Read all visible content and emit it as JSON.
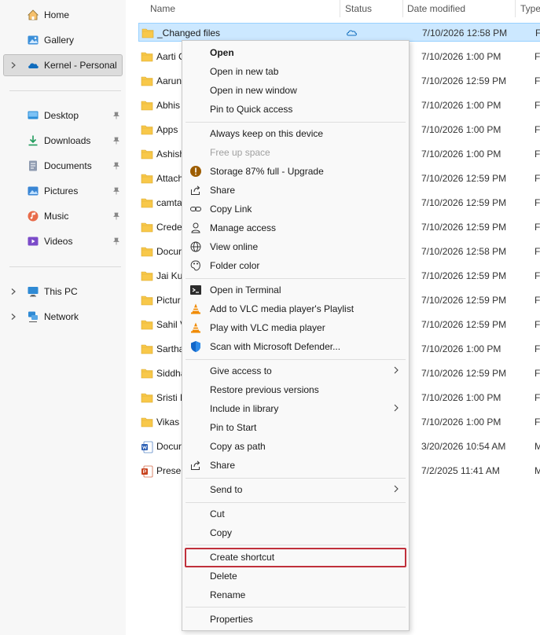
{
  "sidebar": {
    "home": "Home",
    "gallery": "Gallery",
    "kernel": "Kernel - Personal",
    "quick": [
      "Desktop",
      "Downloads",
      "Documents",
      "Pictures",
      "Music",
      "Videos"
    ],
    "this_pc": "This PC",
    "network": "Network"
  },
  "columns": {
    "name": "Name",
    "status": "Status",
    "date": "Date modified",
    "type": "Type"
  },
  "files": [
    {
      "name": "_Changed files",
      "date": "7/10/2026 12:58 PM",
      "type": "File f"
    },
    {
      "name": "Aarti C",
      "date": "7/10/2026 1:00 PM",
      "type": "File f"
    },
    {
      "name": "Aarun",
      "date": "7/10/2026 12:59 PM",
      "type": "File f"
    },
    {
      "name": "Abhis",
      "date": "7/10/2026 1:00 PM",
      "type": "File f"
    },
    {
      "name": "Apps",
      "date": "7/10/2026 1:00 PM",
      "type": "File f"
    },
    {
      "name": "Ashish",
      "date": "7/10/2026 1:00 PM",
      "type": "File f"
    },
    {
      "name": "Attach",
      "date": "7/10/2026 12:59 PM",
      "type": "File f"
    },
    {
      "name": "camta",
      "date": "7/10/2026 12:59 PM",
      "type": "File f"
    },
    {
      "name": "Crede",
      "date": "7/10/2026 12:59 PM",
      "type": "File f"
    },
    {
      "name": "Docur",
      "date": "7/10/2026 12:58 PM",
      "type": "File f"
    },
    {
      "name": "Jai Ku",
      "date": "7/10/2026 12:59 PM",
      "type": "File f"
    },
    {
      "name": "Pictur",
      "date": "7/10/2026 12:59 PM",
      "type": "File f"
    },
    {
      "name": "Sahil V",
      "date": "7/10/2026 12:59 PM",
      "type": "File f"
    },
    {
      "name": "Sartha",
      "date": "7/10/2026 1:00 PM",
      "type": "File f"
    },
    {
      "name": "Siddha",
      "date": "7/10/2026 12:59 PM",
      "type": "File f"
    },
    {
      "name": "Sristi F",
      "date": "7/10/2026 1:00 PM",
      "type": "File f"
    },
    {
      "name": "Vikas",
      "date": "7/10/2026 1:00 PM",
      "type": "File f"
    },
    {
      "name": "Docur",
      "date": "3/20/2026 10:54 AM",
      "type": "Micr"
    },
    {
      "name": "Preser",
      "date": "7/2/2025 11:41 AM",
      "type": "Micr"
    }
  ],
  "menu": {
    "open": "Open",
    "open_tab": "Open in new tab",
    "open_window": "Open in new window",
    "pin_quick": "Pin to Quick access",
    "keep": "Always keep on this device",
    "free": "Free up space",
    "storage": "Storage 87% full - Upgrade",
    "share1": "Share",
    "copy_link": "Copy Link",
    "manage": "Manage access",
    "view_online": "View online",
    "folder_color": "Folder color",
    "terminal": "Open in Terminal",
    "vlc_add": "Add to VLC media player's Playlist",
    "vlc_play": "Play with VLC media player",
    "defender": "Scan with Microsoft Defender...",
    "give_access": "Give access to",
    "restore": "Restore previous versions",
    "include": "Include in library",
    "pin_start": "Pin to Start",
    "copy_path": "Copy as path",
    "share2": "Share",
    "send_to": "Send to",
    "cut": "Cut",
    "copy": "Copy",
    "create_shortcut": "Create shortcut",
    "delete": "Delete",
    "rename": "Rename",
    "properties": "Properties"
  },
  "colors": {
    "selection": "#cce8ff",
    "folder": "#f8c84a",
    "highlight": "#c0303b",
    "onedrive": "#0f6cbd"
  }
}
